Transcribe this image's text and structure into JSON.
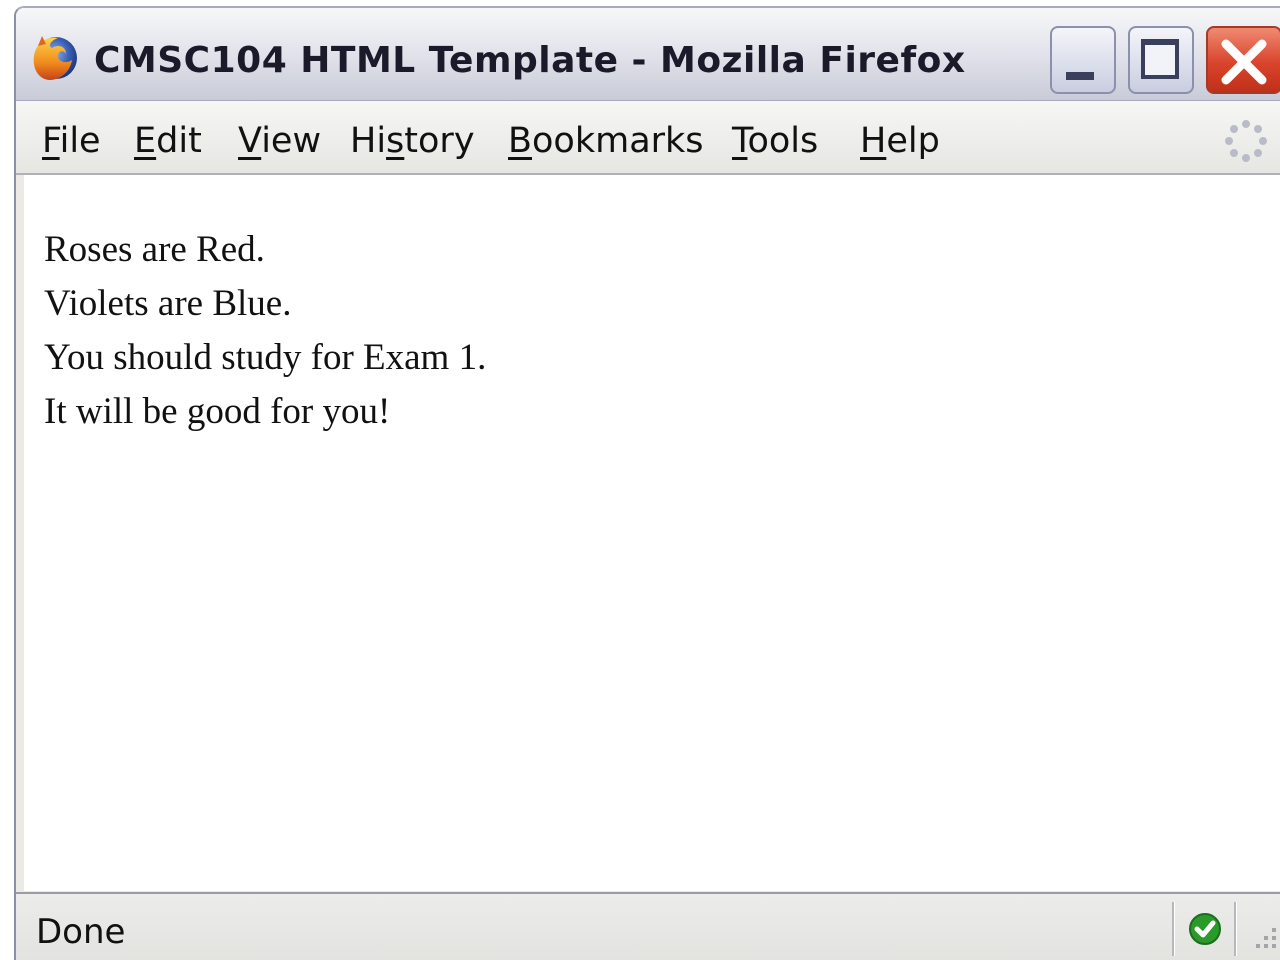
{
  "window": {
    "title": "CMSC104 HTML Template - Mozilla Firefox",
    "app_icon": "firefox-icon",
    "controls": {
      "minimize_icon": "minimize-icon",
      "maximize_icon": "maximize-icon",
      "close_icon": "close-icon"
    }
  },
  "menubar": {
    "items": [
      {
        "accel": "F",
        "rest": "ile"
      },
      {
        "accel": "E",
        "rest": "dit"
      },
      {
        "accel": "V",
        "rest": "iew"
      },
      {
        "pre": "Hi",
        "accel": "s",
        "rest": "tory"
      },
      {
        "accel": "B",
        "rest": "ookmarks"
      },
      {
        "accel": "T",
        "rest": "ools"
      },
      {
        "accel": "H",
        "rest": "elp"
      }
    ],
    "throbber_icon": "activity-throbber-icon"
  },
  "content": {
    "lines": [
      "Roses are Red.",
      "Violets are Blue.",
      "You should study for Exam 1.",
      "It will be good for you!"
    ]
  },
  "statusbar": {
    "text": "Done",
    "security_icon": "check-icon"
  },
  "colors": {
    "close_button": "#d9442c",
    "status_check": "#2a9a2a"
  }
}
